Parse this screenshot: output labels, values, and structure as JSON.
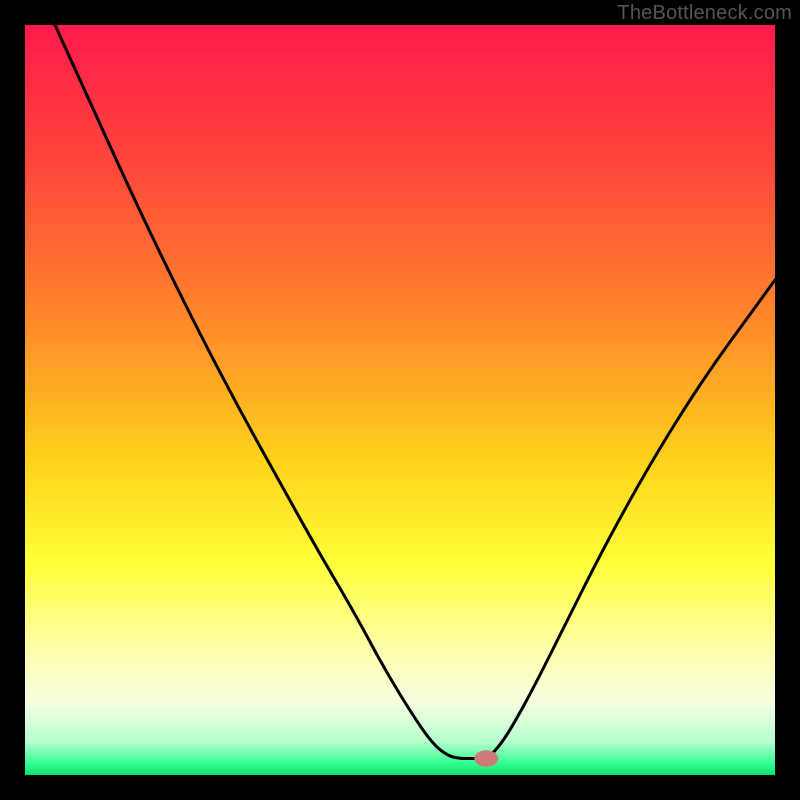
{
  "watermark": "TheBottleneck.com",
  "chart_data": {
    "type": "line",
    "title": "",
    "xlabel": "",
    "ylabel": "",
    "xlim": [
      0,
      100
    ],
    "ylim": [
      0,
      100
    ],
    "grid": false,
    "gradient_stops": [
      {
        "offset": 0.0,
        "color": "#ff1a4b"
      },
      {
        "offset": 0.2,
        "color": "#ff4a3a"
      },
      {
        "offset": 0.4,
        "color": "#ff8a2a"
      },
      {
        "offset": 0.58,
        "color": "#ffd21a"
      },
      {
        "offset": 0.72,
        "color": "#ffff3a"
      },
      {
        "offset": 0.82,
        "color": "#ffffa0"
      },
      {
        "offset": 0.9,
        "color": "#f7ffe0"
      },
      {
        "offset": 0.955,
        "color": "#b8ffd0"
      },
      {
        "offset": 0.985,
        "color": "#30ff90"
      },
      {
        "offset": 1.0,
        "color": "#10e070"
      }
    ],
    "curve": [
      {
        "x": 4.0,
        "y": 100.0
      },
      {
        "x": 9.0,
        "y": 89.0
      },
      {
        "x": 14.0,
        "y": 78.0
      },
      {
        "x": 19.0,
        "y": 67.5
      },
      {
        "x": 24.0,
        "y": 57.5
      },
      {
        "x": 29.0,
        "y": 48.0
      },
      {
        "x": 34.0,
        "y": 39.0
      },
      {
        "x": 39.0,
        "y": 30.0
      },
      {
        "x": 44.0,
        "y": 21.5
      },
      {
        "x": 48.0,
        "y": 14.0
      },
      {
        "x": 52.0,
        "y": 7.5
      },
      {
        "x": 54.5,
        "y": 4.0
      },
      {
        "x": 56.5,
        "y": 2.5
      },
      {
        "x": 58.0,
        "y": 2.2
      },
      {
        "x": 60.0,
        "y": 2.2
      },
      {
        "x": 61.5,
        "y": 2.2
      },
      {
        "x": 63.0,
        "y": 3.5
      },
      {
        "x": 65.0,
        "y": 6.5
      },
      {
        "x": 68.0,
        "y": 12.0
      },
      {
        "x": 72.0,
        "y": 20.0
      },
      {
        "x": 76.0,
        "y": 28.0
      },
      {
        "x": 80.0,
        "y": 35.5
      },
      {
        "x": 84.0,
        "y": 42.5
      },
      {
        "x": 88.0,
        "y": 49.0
      },
      {
        "x": 92.0,
        "y": 55.0
      },
      {
        "x": 96.0,
        "y": 60.5
      },
      {
        "x": 100.0,
        "y": 66.0
      }
    ],
    "marker": {
      "x": 61.5,
      "y": 2.2,
      "rx": 1.6,
      "ry": 1.1,
      "color": "#cf7a78"
    }
  }
}
